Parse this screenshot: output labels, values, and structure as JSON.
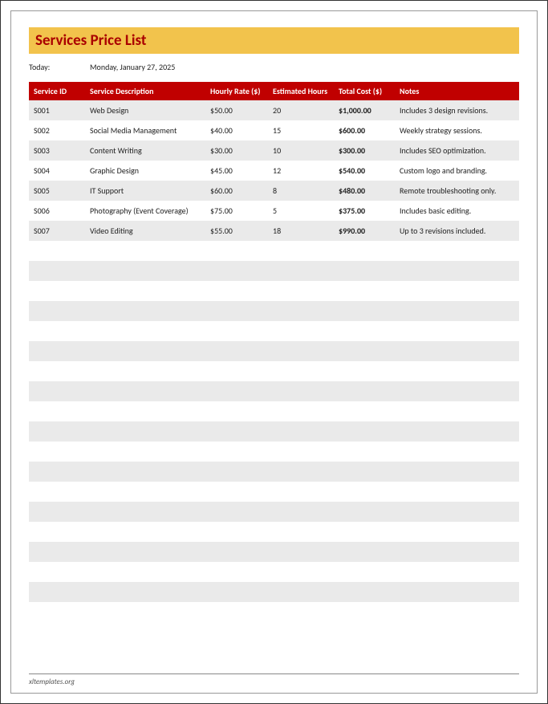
{
  "title": "Services Price List",
  "date_label": "Today:",
  "date_value": "Monday, January 27, 2025",
  "columns": [
    "Service ID",
    "Service Description",
    "Hourly Rate ($)",
    "Estimated Hours",
    "Total Cost ($)",
    "Notes"
  ],
  "rows": [
    {
      "id": "S001",
      "desc": "Web Design",
      "rate": "$50.00",
      "hours": "20",
      "total": "$1,000.00",
      "notes": "Includes 3 design revisions."
    },
    {
      "id": "S002",
      "desc": "Social Media Management",
      "rate": "$40.00",
      "hours": "15",
      "total": "$600.00",
      "notes": "Weekly strategy sessions."
    },
    {
      "id": "S003",
      "desc": "Content Writing",
      "rate": "$30.00",
      "hours": "10",
      "total": "$300.00",
      "notes": "Includes SEO optimization."
    },
    {
      "id": "S004",
      "desc": "Graphic Design",
      "rate": "$45.00",
      "hours": "12",
      "total": "$540.00",
      "notes": "Custom logo and branding."
    },
    {
      "id": "S005",
      "desc": "IT Support",
      "rate": "$60.00",
      "hours": "8",
      "total": "$480.00",
      "notes": "Remote troubleshooting only."
    },
    {
      "id": "S006",
      "desc": "Photography (Event Coverage)",
      "rate": "$75.00",
      "hours": "5",
      "total": "$375.00",
      "notes": "Includes basic editing."
    },
    {
      "id": "S007",
      "desc": "Video Editing",
      "rate": "$55.00",
      "hours": "18",
      "total": "$990.00",
      "notes": "Up to 3 revisions included."
    }
  ],
  "empty_rows": 18,
  "footer": "xltemplates.org"
}
